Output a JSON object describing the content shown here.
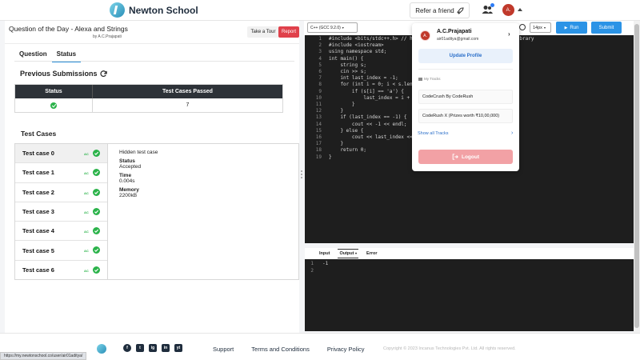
{
  "header": {
    "brand": "Newton School",
    "refer_label": "Refer a friend",
    "avatar_initials": "A."
  },
  "question": {
    "title": "Question of the Day - Alexa and Strings",
    "author": "by A.C.Prajapati",
    "tour_label": "Take a Tour",
    "report_label": "Report",
    "tabs": [
      {
        "label": "Question"
      },
      {
        "label": "Status"
      }
    ]
  },
  "submissions": {
    "title": "Previous Submissions",
    "headers": [
      "Status",
      "Test Cases Passed"
    ],
    "rows": [
      {
        "passed": "7"
      }
    ]
  },
  "test_cases": {
    "title": "Test Cases",
    "badge": "AC",
    "items": [
      {
        "name": "Test case 0"
      },
      {
        "name": "Test case 1"
      },
      {
        "name": "Test case 2"
      },
      {
        "name": "Test case 3"
      },
      {
        "name": "Test case 4"
      },
      {
        "name": "Test case 5"
      },
      {
        "name": "Test case 6"
      }
    ],
    "detail": {
      "hidden": "Hidden test case",
      "status_label": "Status",
      "status_value": "Accepted",
      "time_label": "Time",
      "time_value": "0.004s",
      "memory_label": "Memory",
      "memory_value": "2200kB"
    }
  },
  "editor": {
    "language": "C++ (GCC 9.2.0)",
    "font_size": "14px",
    "run_label": "Run",
    "submit_label": "Submit",
    "lines": [
      "#include <bits/stdc++.h> // header file includes every Standard library",
      "#include <iostream>",
      "using namespace std;",
      "int main() {",
      "    string s;",
      "    cin >> s;",
      "    int last_index = -1;",
      "    for (int i = 0; i < s.length(); i++) {",
      "        if (s[i] == 'a') {",
      "            last_index = i + 1;",
      "        }",
      "    }",
      "    if (last_index == -1) {",
      "        cout << -1 << endl;",
      "    } else {",
      "        cout << last_index << endl;",
      "    }",
      "    return 0;",
      "}"
    ]
  },
  "console": {
    "tabs": [
      {
        "label": "Input"
      },
      {
        "label": "Output"
      },
      {
        "label": "Error"
      }
    ],
    "output_lines": [
      "-1",
      ""
    ]
  },
  "profile": {
    "initials": "A.",
    "name": "A.C.Prajapati",
    "email": "air01aditya@gmail.com",
    "update_label": "Update Profile",
    "tracks_label": "My Tracks",
    "tracks": [
      {
        "label": "CodeCrush By CodeRush"
      },
      {
        "label": "CodeRush X (Prizes worth ₹10,00,000)"
      }
    ],
    "show_all": "Show all Tracks",
    "logout_label": "Logout"
  },
  "footer": {
    "socials": [
      "f",
      "t",
      "ig",
      "in",
      "yt"
    ],
    "links": [
      {
        "label": "Support"
      },
      {
        "label": "Terms and Conditions"
      },
      {
        "label": "Privacy Policy"
      }
    ],
    "copyright": "Copyright © 2023 Incanus Technologies Pvt. Ltd. All rights reserved."
  },
  "status_url": "https://my.newtonschool.co/user/air01aditya/",
  "colors": {
    "accent": "#2b93e6",
    "report": "#e0414b",
    "success": "#2bb34a",
    "editor_bg": "#1e1e1e"
  }
}
